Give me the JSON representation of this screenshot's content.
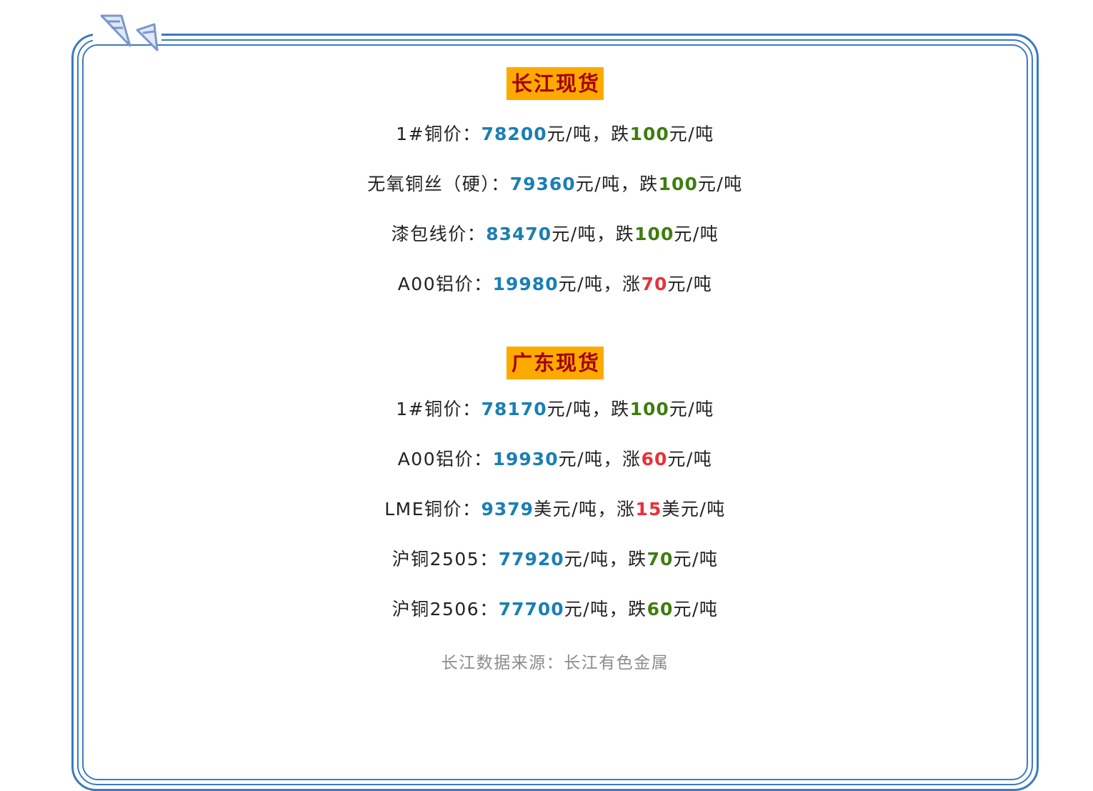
{
  "colors": {
    "frame": "#3a7bbf",
    "heading_bg": "#fdaa00",
    "heading_text": "#a30000",
    "value": "#1a7fb5",
    "down": "#3f7d0e",
    "up": "#e8313a",
    "source": "#8c8c8c"
  },
  "icons": [
    "pennant-flag-icon",
    "pennant-flag-icon"
  ],
  "sections": [
    {
      "heading": "长江现货",
      "rows": [
        {
          "label": "1#铜价：",
          "value": "78200",
          "unit": "元/吨，",
          "dir": "跌",
          "change": "100",
          "change_unit": "元/吨",
          "trend": "down"
        },
        {
          "label": "无氧铜丝（硬）：",
          "value": "79360",
          "unit": "元/吨，",
          "dir": "跌",
          "change": "100",
          "change_unit": "元/吨",
          "trend": "down"
        },
        {
          "label": "漆包线价：",
          "value": "83470",
          "unit": "元/吨，",
          "dir": "跌",
          "change": "100",
          "change_unit": "元/吨",
          "trend": "down"
        },
        {
          "label": "A00铝价：",
          "value": "19980",
          "unit": "元/吨，",
          "dir": "涨",
          "change": "70",
          "change_unit": "元/吨",
          "trend": "up"
        }
      ]
    },
    {
      "heading": "广东现货",
      "rows": [
        {
          "label": "1#铜价：",
          "value": "78170",
          "unit": "元/吨，",
          "dir": "跌",
          "change": "100",
          "change_unit": "元/吨",
          "trend": "down"
        },
        {
          "label": "A00铝价：",
          "value": "19930",
          "unit": "元/吨，",
          "dir": "涨",
          "change": "60",
          "change_unit": "元/吨",
          "trend": "up"
        },
        {
          "label": "LME铜价：",
          "value": "9379",
          "unit": "美元/吨，",
          "dir": "涨",
          "change": "15",
          "change_unit": "美元/吨",
          "trend": "up"
        },
        {
          "label": "沪铜2505：",
          "value": "77920",
          "unit": "元/吨，",
          "dir": "跌",
          "change": "70",
          "change_unit": "元/吨",
          "trend": "down"
        },
        {
          "label": "沪铜2506：",
          "value": "77700",
          "unit": "元/吨，",
          "dir": "跌",
          "change": "60",
          "change_unit": "元/吨",
          "trend": "down"
        }
      ]
    }
  ],
  "source": "长江数据来源：长江有色金属"
}
